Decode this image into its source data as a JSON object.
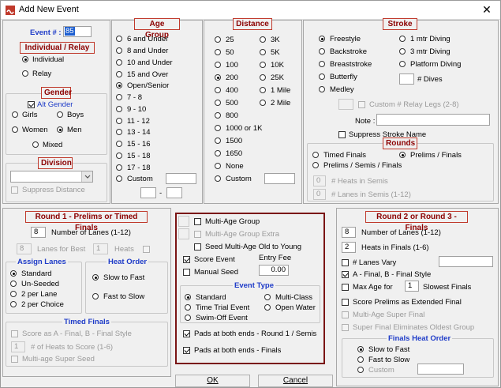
{
  "window": {
    "title": "Add New Event",
    "close_glyph": "✕"
  },
  "event_num": {
    "label": "Event # :",
    "value": "85"
  },
  "individual_relay": {
    "header": "Individual / Relay",
    "options": [
      "Individual",
      "Relay"
    ],
    "selected": "Individual"
  },
  "gender": {
    "header": "Gender",
    "alt_gender_label": "Alt Gender",
    "alt_gender_checked": true,
    "options": [
      "Girls",
      "Boys",
      "Women",
      "Men",
      "Mixed"
    ],
    "selected": "Men"
  },
  "division": {
    "header": "Division",
    "value": "",
    "suppress_distance_label": "Suppress Distance"
  },
  "age_group": {
    "header": "Age Group",
    "options": [
      "6 and Under",
      "8 and Under",
      "10 and Under",
      "15 and Over",
      "Open/Senior",
      "7 - 8",
      "9 - 10",
      "11 - 12",
      "13 - 14",
      "15 - 16",
      "15 - 18",
      "17 - 18",
      "Custom"
    ],
    "selected": "Open/Senior",
    "custom_value": "",
    "range_low": "",
    "range_sep": "-",
    "range_high": ""
  },
  "distance": {
    "header": "Distance",
    "col1": [
      "25",
      "50",
      "100",
      "200",
      "400",
      "500",
      "800",
      "1000 or 1K",
      "1500",
      "1650",
      "None",
      "Custom"
    ],
    "col2": [
      "3K",
      "5K",
      "10K",
      "25K",
      "1 Mile",
      "2 Mile"
    ],
    "selected": "200",
    "custom_value": ""
  },
  "stroke": {
    "header": "Stroke",
    "col1": [
      "Freestyle",
      "Backstroke",
      "Breaststroke",
      "Butterfly",
      "Medley"
    ],
    "col2": [
      "1 mtr Diving",
      "3 mtr Diving",
      "Platform Diving"
    ],
    "selected": "Freestyle",
    "dives_label": "# Dives",
    "dives_value": "",
    "relay_legs_label": "Custom # Relay Legs (2-8)",
    "relay_legs_value": "",
    "note_label": "Note :",
    "note_value": "",
    "suppress_stroke_label": "Suppress Stroke Name"
  },
  "rounds": {
    "header": "Rounds",
    "options": [
      "Timed Finals",
      "Prelims / Finals",
      "Prelims / Semis / Finals"
    ],
    "selected": "Prelims / Finals",
    "heats_semis_label": "# Heats in Semis",
    "heats_semis_value": "0",
    "lanes_semis_label": "# Lanes in Semis (1-12)",
    "lanes_semis_value": "0"
  },
  "round1": {
    "header": "Round 1 - Prelims or Timed Finals",
    "lanes_label": "Number of Lanes (1-12)",
    "lanes_value": "8",
    "lanes_best_value": "8",
    "lanes_best_label": "Lanes for Best",
    "heats_value": "1",
    "heats_label": "Heats",
    "assign_lanes": {
      "header": "Assign Lanes",
      "options": [
        "Standard",
        "Un-Seeded",
        "2 per Lane",
        "2 per Choice"
      ],
      "selected": "Standard"
    },
    "heat_order": {
      "header": "Heat Order",
      "options": [
        "Slow to Fast",
        "Fast to Slow"
      ],
      "selected": "Slow to Fast"
    },
    "timed_finals": {
      "header": "Timed Finals",
      "score_label": "Score as A - Final, B - Final Style",
      "heats_value": "1",
      "heats_label": "# of Heats to Score (1-6)",
      "multiage_label": "Multi-age Super Seed"
    }
  },
  "middle": {
    "multi_age_group": "Multi-Age Group",
    "multi_age_extra": "Multi-Age Group Extra",
    "seed_multi_age": "Seed Multi-Age Old to Young",
    "score_event": "Score Event",
    "entry_fee_label": "Entry Fee",
    "manual_seed": "Manual Seed",
    "entry_fee_value": "0.00",
    "event_type": {
      "header": "Event Type",
      "options": [
        "Standard",
        "Multi-Class",
        "Time Trial Event",
        "Open Water",
        "Swim-Off Event"
      ],
      "selected": "Standard"
    },
    "pads_round1": "Pads at both ends - Round 1 / Semis",
    "pads_finals": "Pads at both ends - Finals"
  },
  "round23": {
    "header": "Round 2 or Round 3 - Finals",
    "lanes_value": "8",
    "lanes_label": "Number of Lanes (1-12)",
    "heats_value": "2",
    "heats_label": "Heats in Finals (1-6)",
    "lanes_vary_label": "# Lanes Vary",
    "ab_final_label": "A - Final, B - Final Style",
    "max_age_label": "Max Age for",
    "max_age_value": "1",
    "slowest_finals_label": "Slowest Finals",
    "score_prelims_label": "Score Prelims as Extended Final",
    "multiage_super_label": "Multi-Age Super Final",
    "super_final_label": "Super Final Eliminates Oldest Group",
    "finals_heat_order": {
      "header": "Finals Heat Order",
      "options": [
        "Slow to Fast",
        "Fast to Slow",
        "Custom"
      ],
      "selected": "Slow to Fast",
      "custom_value": ""
    }
  },
  "buttons": {
    "ok": "OK",
    "cancel": "Cancel"
  },
  "colors": {
    "red_header": "#8b0000",
    "blue_header": "#1f3cc8",
    "dialog_bg": "#f0f0f0"
  }
}
